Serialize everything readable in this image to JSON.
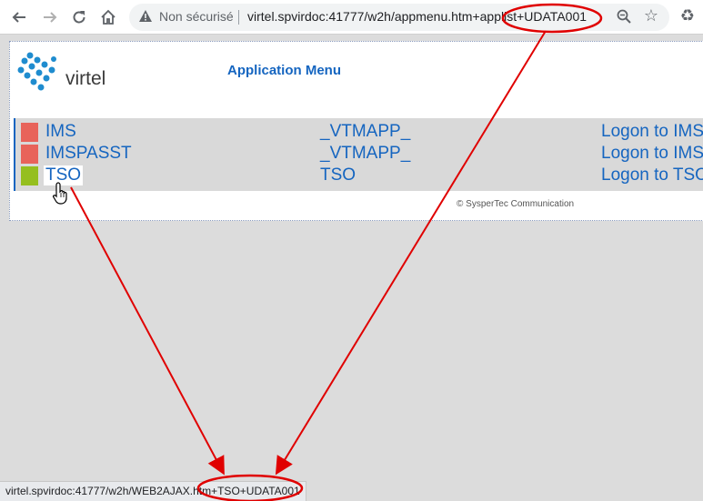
{
  "browser": {
    "security_label": "Non sécurisé",
    "url": "virtel.spvirdoc:41777/w2h/appmenu.htm+applist+UDATA001",
    "status_url": "virtel.spvirdoc:41777/w2h/WEB2AJAX.htm+TSO+UDATA001",
    "icons": [
      "back-icon",
      "forward-icon",
      "reload-icon",
      "home-icon",
      "warning-icon",
      "zoom-icon",
      "star-icon",
      "extension-icon"
    ]
  },
  "page": {
    "logo_text": "virtel",
    "title": "Application Menu",
    "copyright": "© SysperTec Communication",
    "applications": [
      {
        "name": "IMS",
        "template": "_VTMAPP_",
        "description": "Logon to IMS",
        "status_color": "#e8635a"
      },
      {
        "name": "IMSPASST",
        "template": "_VTMAPP_",
        "description": "Logon to IMS",
        "status_color": "#e8635a"
      },
      {
        "name": "TSO",
        "template": "TSO",
        "description": "Logon to TSO",
        "status_color": "#95bf1f"
      }
    ]
  },
  "colors": {
    "link": "#1565c0",
    "annotation": "#e00000"
  }
}
